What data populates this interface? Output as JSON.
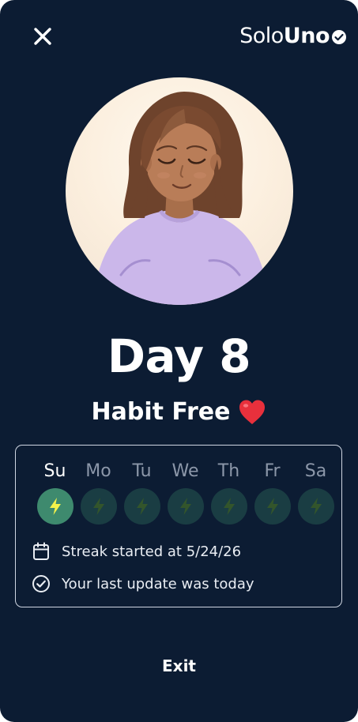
{
  "header": {
    "close_icon": "close-icon",
    "logo": {
      "part1": "Solo",
      "part2": "Uno",
      "badge_icon": "check-circle-icon"
    }
  },
  "avatar": {
    "description_icon": "meditating-woman-illustration"
  },
  "main": {
    "day_title": "Day 8",
    "subtitle": "Habit Free",
    "subtitle_emoji": "❤️"
  },
  "streak": {
    "days": [
      {
        "label": "Su",
        "completed": true
      },
      {
        "label": "Mo",
        "completed": false
      },
      {
        "label": "Tu",
        "completed": false
      },
      {
        "label": "We",
        "completed": false
      },
      {
        "label": "Th",
        "completed": false
      },
      {
        "label": "Fr",
        "completed": false
      },
      {
        "label": "Sa",
        "completed": false
      }
    ],
    "started_text": "Streak started at 5/24/26",
    "started_icon": "calendar-icon",
    "last_update_text": "Your last update was today",
    "last_update_icon": "check-circle-icon"
  },
  "footer": {
    "exit_label": "Exit"
  },
  "colors": {
    "background": "#0c1c33",
    "completed_day": "#3e8a6e",
    "pending_day": "#1a3d43",
    "bolt_active": "#f4f24a",
    "bolt_inactive": "#33552b"
  }
}
